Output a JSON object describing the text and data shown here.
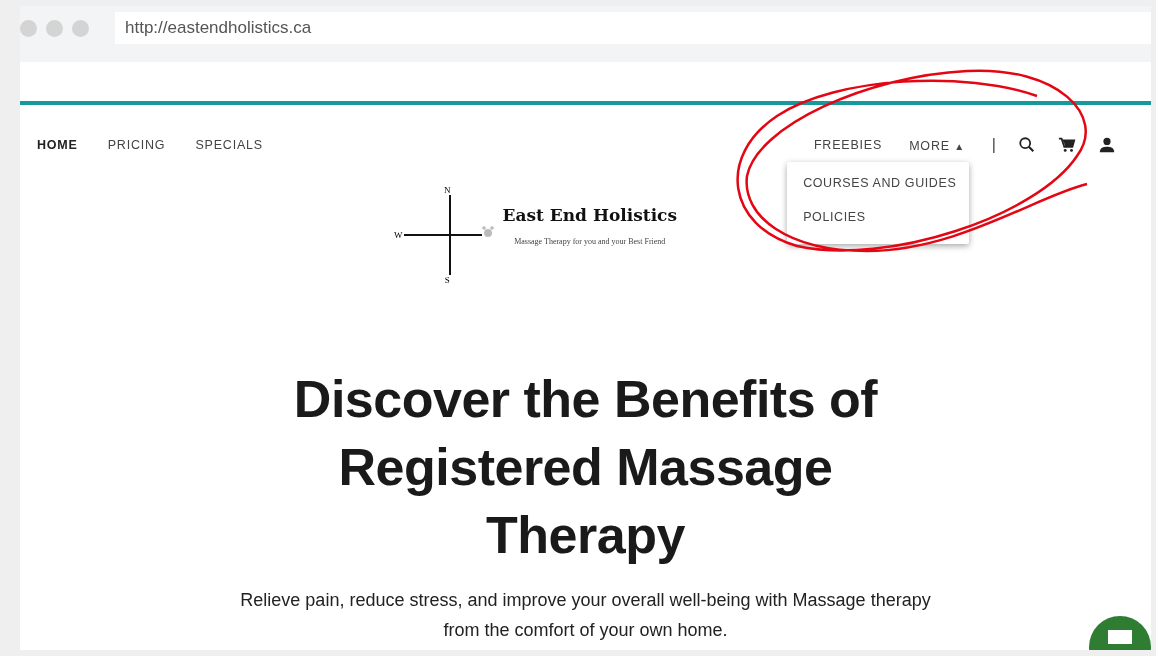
{
  "browser": {
    "url": "http://eastendholistics.ca"
  },
  "nav_left": [
    {
      "label": "HOME",
      "selected": true
    },
    {
      "label": "PRICING",
      "selected": false
    },
    {
      "label": "SPECIALS",
      "selected": false
    }
  ],
  "nav_right": [
    {
      "label": "FREEBIES",
      "kind": "link"
    },
    {
      "label": "MORE",
      "kind": "dropdown",
      "expanded": true,
      "caret": "▲"
    }
  ],
  "separator": "|",
  "dropdown": [
    "COURSES AND GUIDES",
    "POLICIES"
  ],
  "logo": {
    "north": "N",
    "west": "W",
    "south": "S",
    "name": "East End Holistics",
    "tagline": "Massage Therapy for you and your Best Friend"
  },
  "hero": {
    "heading": "Discover the Benefits of Registered Massage Therapy",
    "text": "Relieve pain, reduce stress, and improve your overall well-being with Massage therapy from the comfort of your own home."
  }
}
